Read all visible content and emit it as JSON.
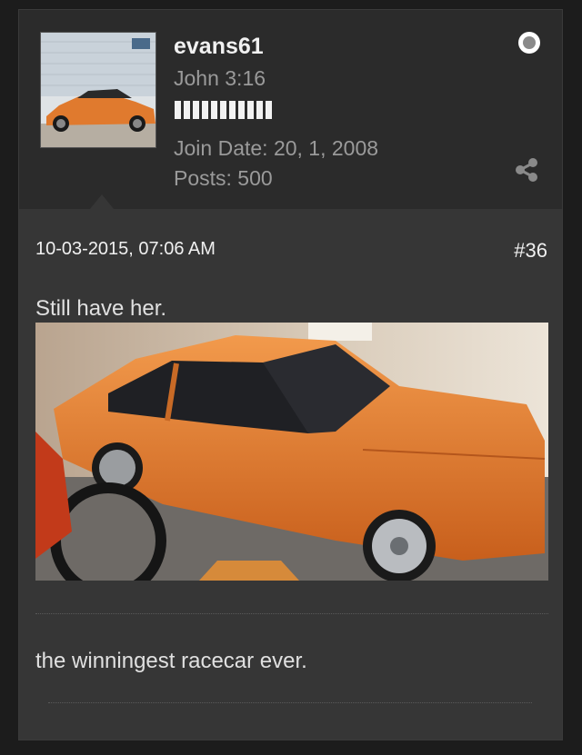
{
  "post": {
    "username": "evans61",
    "user_title": "John 3:16",
    "reputation_pips": 11,
    "join_date": "Join Date: 20, 1, 2008",
    "posts": "Posts: 500",
    "date": "10-03-2015, 07:06 AM",
    "post_number": "#36",
    "message_line1": "Still have her.",
    "message_line2": "the winningest racecar ever."
  },
  "icons": {
    "status": "offline-status-icon",
    "share": "share-icon"
  },
  "colors": {
    "background": "#1c1c1c",
    "header": "#2b2b2b",
    "body": "#363636",
    "car": "#e07a2e"
  }
}
